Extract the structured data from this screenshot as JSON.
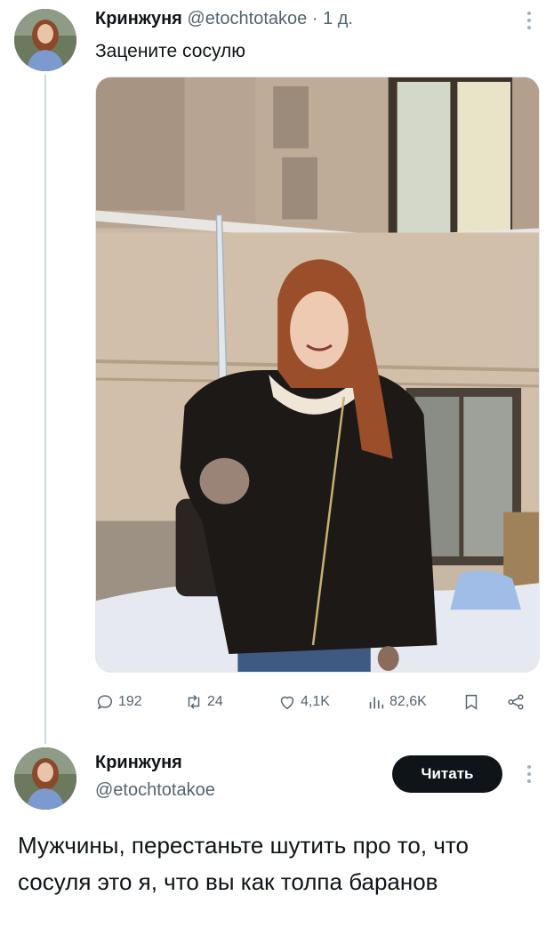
{
  "tweet": {
    "author_name": "Кринжуня",
    "author_handle": "@etochtotakoe",
    "separator": "·",
    "time": "1 д.",
    "text": "Зацените сосулю",
    "avatar_icon": "avatar-photo-icon",
    "media_description_icon": "photo-woman-holding-icicle"
  },
  "actions": {
    "replies": "192",
    "retweets": "24",
    "likes": "4,1K",
    "views": "82,6K"
  },
  "reply": {
    "author_name": "Кринжуня",
    "author_handle": "@etochtotakoe",
    "follow_label": "Читать",
    "text": "Мужчины, перестаньте шутить про то, что сосуля это я, что вы как толпа баранов"
  },
  "colors": {
    "text_primary": "#0f1419",
    "text_secondary": "#536471",
    "thread_line": "#cfd9de",
    "button_bg": "#0f1419"
  }
}
